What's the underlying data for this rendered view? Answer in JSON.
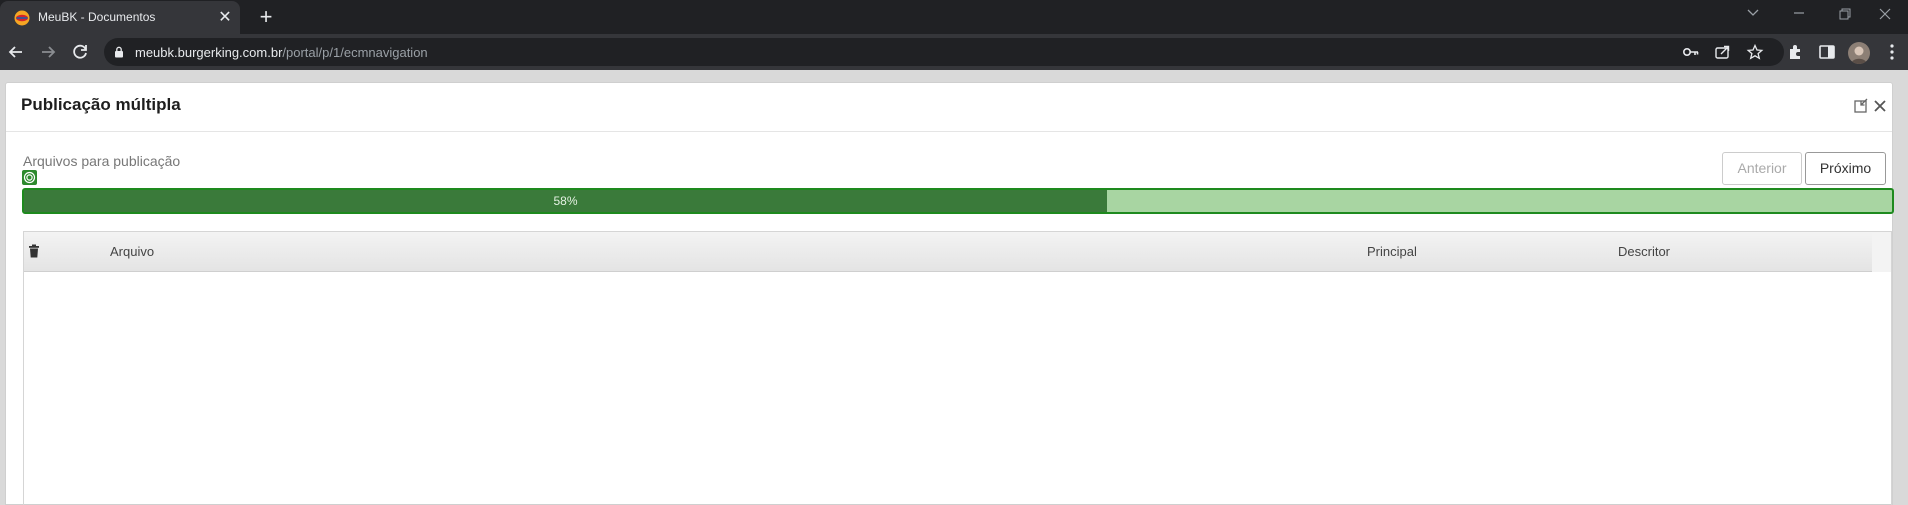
{
  "browser": {
    "tab_title": "MeuBK - Documentos",
    "url_host": "meubk.burgerking.com.br",
    "url_path": "/portal/p/1/ecmnavigation"
  },
  "modal": {
    "title": "Publicação múltipla",
    "section_label": "Arquivos para publicação",
    "prev_label": "Anterior",
    "next_label": "Próximo",
    "progress": {
      "value": 58,
      "label": "58%"
    },
    "table": {
      "columns": {
        "file": "Arquivo",
        "main": "Principal",
        "descriptor": "Descritor"
      },
      "rows": []
    }
  }
}
